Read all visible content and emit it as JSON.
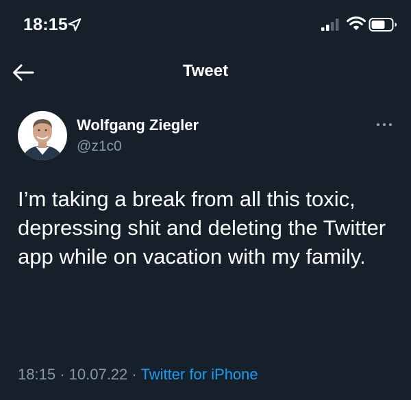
{
  "status_bar": {
    "time": "18:15",
    "icons": [
      "location-arrow-icon",
      "cellular-signal-icon",
      "wifi-icon",
      "battery-icon"
    ]
  },
  "nav": {
    "back_icon": "arrow-left-icon",
    "title": "Tweet"
  },
  "tweet": {
    "author": {
      "display_name": "Wolfgang Ziegler",
      "handle": "@z1c0"
    },
    "text": "I’m taking a break from all this toxic, depressing shit and deleting the Twitter app while on vacation with my family.",
    "time": "18:15",
    "date": "10.07.22",
    "separator": "·",
    "source": "Twitter for iPhone"
  },
  "colors": {
    "background": "#15202b",
    "text_primary": "#ffffff",
    "text_secondary": "#8899a6",
    "link": "#1d9bf0"
  }
}
